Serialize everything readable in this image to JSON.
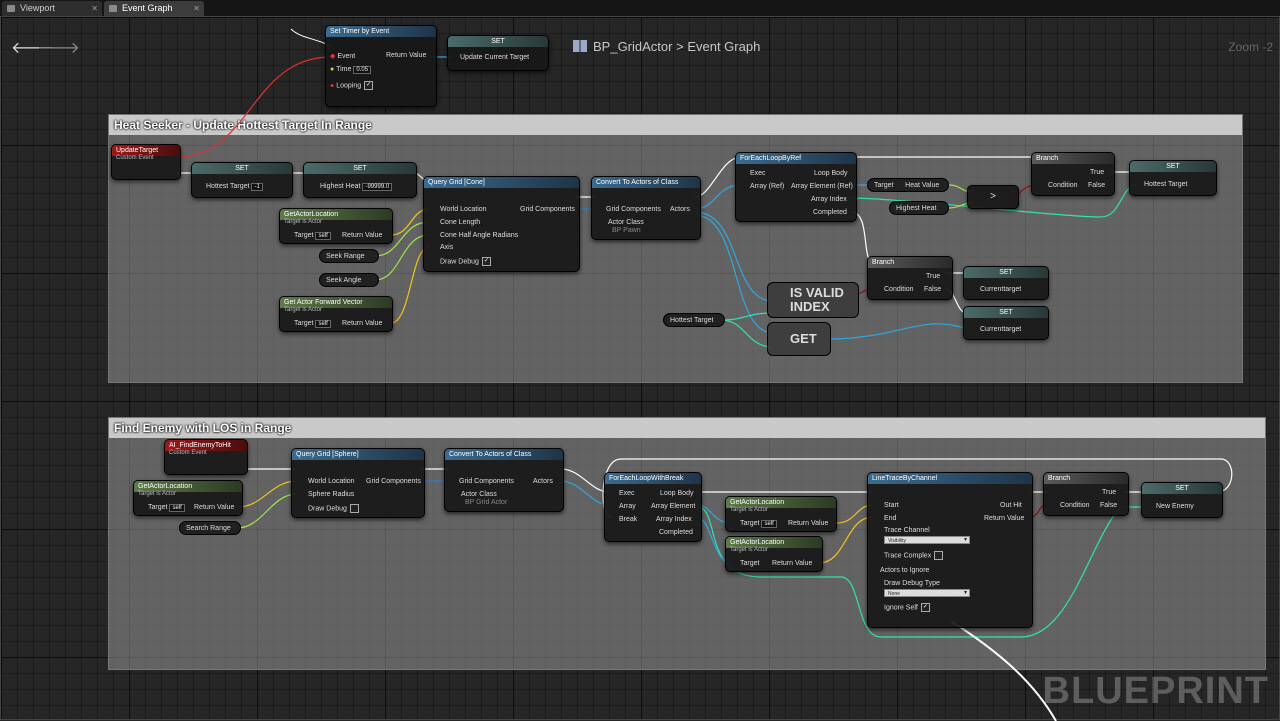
{
  "tabs": [
    {
      "label": "Viewport"
    },
    {
      "label": "Event Graph"
    }
  ],
  "breadcrumb": {
    "blueprint": "BP_GridActor",
    "separator": ">",
    "graph": "Event Graph"
  },
  "zoom": "Zoom -2",
  "logo": "BLUEPRINT",
  "colors": {
    "exec": "#ffffff",
    "object": "#2fa8e0",
    "float": "#a0e54c",
    "vector": "#f5c518",
    "bool": "#8e1010",
    "int": "#2ee4b0",
    "struct": "#2a7fd6"
  },
  "timer": {
    "title": "Set Timer by Event",
    "event": "Event",
    "time": "Time",
    "time_value": "0.05",
    "looping": "Looping",
    "return_value": "Return Value",
    "set_title": "SET",
    "set_pin": "Update Current Target"
  },
  "comments": [
    {
      "title": "Heat Seeker - Update Hottest Target In Range"
    },
    {
      "title": "Find Enemy with LOS in Range"
    }
  ],
  "heat": {
    "update_target": {
      "title": "UpdateTarget",
      "sub": "Custom Event"
    },
    "set1": {
      "title": "SET",
      "pin": "Hottest Target",
      "value": "-1"
    },
    "set2": {
      "title": "SET",
      "pin": "Highest Heat",
      "value": "-99999.0"
    },
    "get_loc": {
      "title": "GetActorLocation",
      "sub": "Target is Actor",
      "target": "Target",
      "self": "self",
      "ret": "Return Value"
    },
    "seek_range": "Seek Range",
    "seek_angle": "Seek Angle",
    "get_fwd": {
      "title": "Get Actor Forward Vector",
      "sub": "Target is Actor",
      "target": "Target",
      "self": "self",
      "ret": "Return Value"
    },
    "query": {
      "title": "Query Grid [Cone]",
      "world": "World Location",
      "cone": "Cone Length",
      "half": "Cone Half Angle Radians",
      "axis": "Axis",
      "debug": "Draw Debug",
      "out": "Grid Components"
    },
    "convert": {
      "title": "Convert To Actors of Class",
      "in": "Grid Components",
      "cls": "Actor Class",
      "cls_value": "BP Pawn",
      "out": "Actors"
    },
    "foreach": {
      "title": "ForEachLoopByRef",
      "exec": "Exec",
      "array": "Array (Ref)",
      "body": "Loop Body",
      "elem": "Array Element (Ref)",
      "idx": "Array Index",
      "done": "Completed"
    },
    "heat_target": "Target",
    "heat_value": "Heat Value",
    "highest_heat": "Highest Heat",
    "gt": ">",
    "branch1": {
      "title": "Branch",
      "cond": "Condition",
      "t": "True",
      "f": "False"
    },
    "set3": {
      "title": "SET",
      "pin": "Hottest Target"
    },
    "branch2": {
      "title": "Branch",
      "cond": "Condition",
      "t": "True",
      "f": "False"
    },
    "set4": {
      "title": "SET",
      "pin": "Currenttarget"
    },
    "set5": {
      "title": "SET",
      "pin": "Currenttarget"
    },
    "is_valid": "IS VALID INDEX",
    "get": "GET",
    "hottest_var": "Hottest Target"
  },
  "enemy": {
    "event": {
      "title": "AI_FindEnemyToHit",
      "sub": "Custom Event"
    },
    "get_loc": {
      "title": "GetActorLocation",
      "sub": "Target is Actor",
      "target": "Target",
      "self": "self",
      "ret": "Return Value"
    },
    "search_range": "Search Range",
    "query": {
      "title": "Query Grid [Sphere]",
      "world": "World Location",
      "radius": "Sphere Radius",
      "debug": "Draw Debug",
      "out": "Grid Components"
    },
    "convert": {
      "title": "Convert To Actors of Class",
      "in": "Grid Components",
      "cls": "Actor Class",
      "cls_value": "BP Grid Actor",
      "out": "Actors"
    },
    "foreach": {
      "title": "ForEachLoopWithBreak",
      "exec": "Exec",
      "array": "Array",
      "brk": "Break",
      "body": "Loop Body",
      "elem": "Array Element",
      "idx": "Array Index",
      "done": "Completed"
    },
    "get_loc2": {
      "title": "GetActorLocation",
      "sub": "Target is Actor",
      "target": "Target",
      "self": "self",
      "ret": "Return Value"
    },
    "get_loc3": {
      "title": "GetActorLocation",
      "sub": "Target is Actor",
      "target": "Target",
      "ret": "Return Value"
    },
    "trace": {
      "title": "LineTraceByChannel",
      "start": "Start",
      "end": "End",
      "channel": "Trace Channel",
      "channel_value": "Visibility",
      "complex": "Trace Complex",
      "ignore": "Actors to Ignore",
      "dtype": "Draw Debug Type",
      "dtype_value": "None",
      "self": "Ignore Self",
      "hit": "Out Hit",
      "ret": "Return Value"
    },
    "branch": {
      "title": "Branch",
      "cond": "Condition",
      "t": "True",
      "f": "False"
    },
    "set": {
      "title": "SET",
      "pin": "New Enemy"
    }
  }
}
